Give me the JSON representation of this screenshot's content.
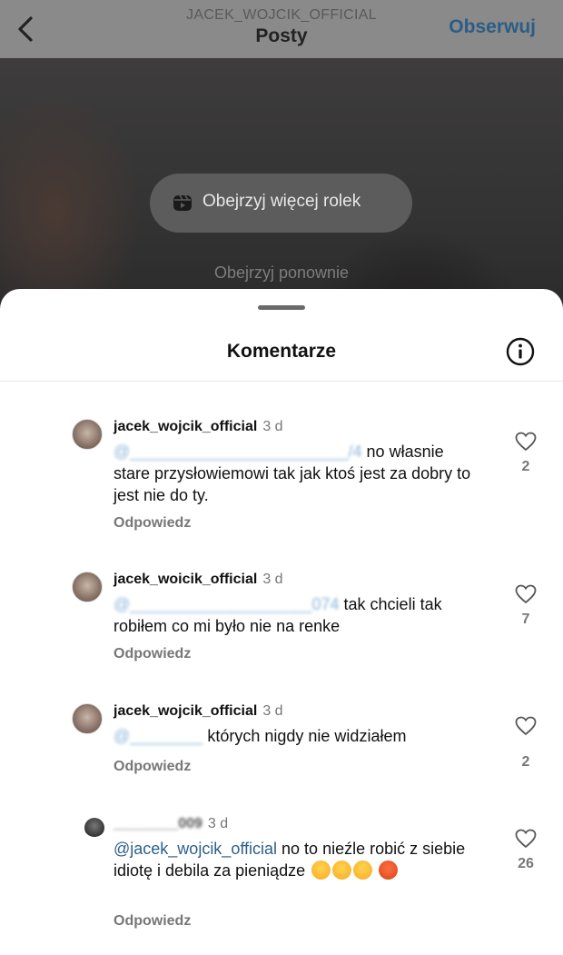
{
  "header": {
    "username": "JACEK_WOJCIK_OFFICIAL",
    "title": "Posty",
    "follow_label": "Obserwuj"
  },
  "video": {
    "more_reels_label": "Obejrzyj więcej rolek",
    "replay_label": "Obejrzyj ponownie"
  },
  "sheet": {
    "title": "Komentarze"
  },
  "comments": [
    {
      "user": "jacek_wojcik_official",
      "time": "3 d",
      "mention": "@________________________/4",
      "text": " no własnie stare przysłowiemowi tak jak ktoś jest za dobry to jest nie do ty.",
      "reply": "Odpowiedz",
      "likes": "2"
    },
    {
      "user": "jacek_woicik_official",
      "time": "3 d",
      "mention": "@____________________074",
      "text": " tak chcieli tak robiłem co mi było nie na renke",
      "reply": "Odpowiedz",
      "likes": "7"
    },
    {
      "user": "jacek_wojcik_official",
      "time": "3 d",
      "mention": "@________",
      "text": " których nigdy nie widziałem",
      "reply": "Odpowiedz",
      "likes": "2"
    },
    {
      "user": "________009",
      "time": "3 d",
      "mention": "@jacek_wojcik_official",
      "text": " no to nieźle robić z siebie idiotę  i debila za pieniądze",
      "reply": "Odpowiedz",
      "likes": "26"
    }
  ]
}
